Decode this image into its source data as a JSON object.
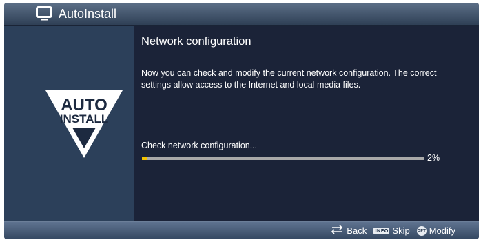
{
  "window": {
    "title": "AutoInstall",
    "icon": "tv-icon"
  },
  "sidebar": {
    "logo_line1": "AUTO",
    "logo_line2": "INSTALL"
  },
  "main": {
    "heading": "Network configuration",
    "description": "Now you can check and modify the current network configuration. The correct settings allow access to the Internet and local media files.",
    "status_text": "Check network configuration...",
    "progress_label": "2%",
    "progress_percent": 2
  },
  "footer": {
    "back_label": "Back",
    "info_key_label": "INFO",
    "skip_label": "Skip",
    "opt_key_label": "OPT",
    "modify_label": "Modify"
  },
  "colors": {
    "background": "#1b2338",
    "sidebar": "#2c405a",
    "progress_fill": "#f2c200",
    "progress_track": "#a9a9a9"
  }
}
